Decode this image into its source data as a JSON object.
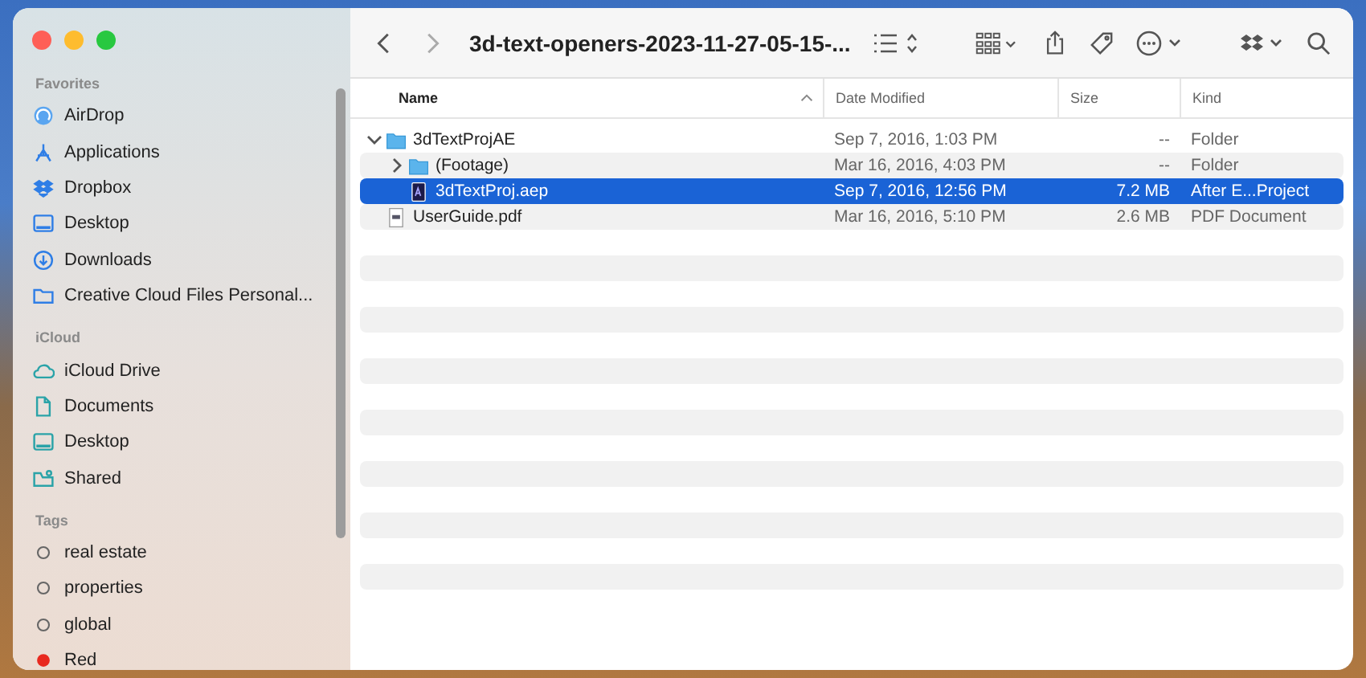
{
  "toolbar": {
    "title": "3d-text-openers-2023-11-27-05-15-..."
  },
  "sidebar": {
    "sections": [
      {
        "heading": "Favorites",
        "items": [
          {
            "label": "AirDrop",
            "kind": "airdrop"
          },
          {
            "label": "Applications",
            "kind": "apps"
          },
          {
            "label": "Dropbox",
            "kind": "dropbox"
          },
          {
            "label": "Desktop",
            "kind": "desktop"
          },
          {
            "label": "Downloads",
            "kind": "download"
          },
          {
            "label": "Creative Cloud Files Personal...",
            "kind": "folder"
          }
        ]
      },
      {
        "heading": "iCloud",
        "items": [
          {
            "label": "iCloud Drive",
            "kind": "cloud"
          },
          {
            "label": "Documents",
            "kind": "doc"
          },
          {
            "label": "Desktop",
            "kind": "desktop"
          },
          {
            "label": "Shared",
            "kind": "shared"
          }
        ]
      },
      {
        "heading": "Tags",
        "items": [
          {
            "label": "real estate",
            "kind": "tag"
          },
          {
            "label": "properties",
            "kind": "tag"
          },
          {
            "label": "global",
            "kind": "tag"
          },
          {
            "label": "Red",
            "kind": "tag",
            "color": "#e8291f"
          }
        ]
      }
    ]
  },
  "table": {
    "columns": [
      "Name",
      "Date Modified",
      "Size",
      "Kind"
    ],
    "rows": [
      {
        "name": "3dTextProjAE",
        "kind": "folder",
        "date": "Sep 7, 2016, 1:03 PM",
        "size": "--",
        "file_kind": "Folder",
        "expanded": true,
        "selected": false,
        "children": [
          {
            "name": "(Footage)",
            "kind": "folder",
            "date": "Mar 16, 2016, 4:03 PM",
            "size": "--",
            "file_kind": "Folder",
            "expanded": false,
            "selected": false
          },
          {
            "name": "3dTextProj.aep",
            "kind": "aep",
            "date": "Sep 7, 2016, 12:56 PM",
            "size": "7.2 MB",
            "file_kind": "After E...Project",
            "selected": true
          }
        ]
      },
      {
        "name": "UserGuide.pdf",
        "kind": "pdf",
        "date": "Mar 16, 2016, 5:10 PM",
        "size": "2.6 MB",
        "file_kind": "PDF Document",
        "selected": false
      }
    ]
  }
}
